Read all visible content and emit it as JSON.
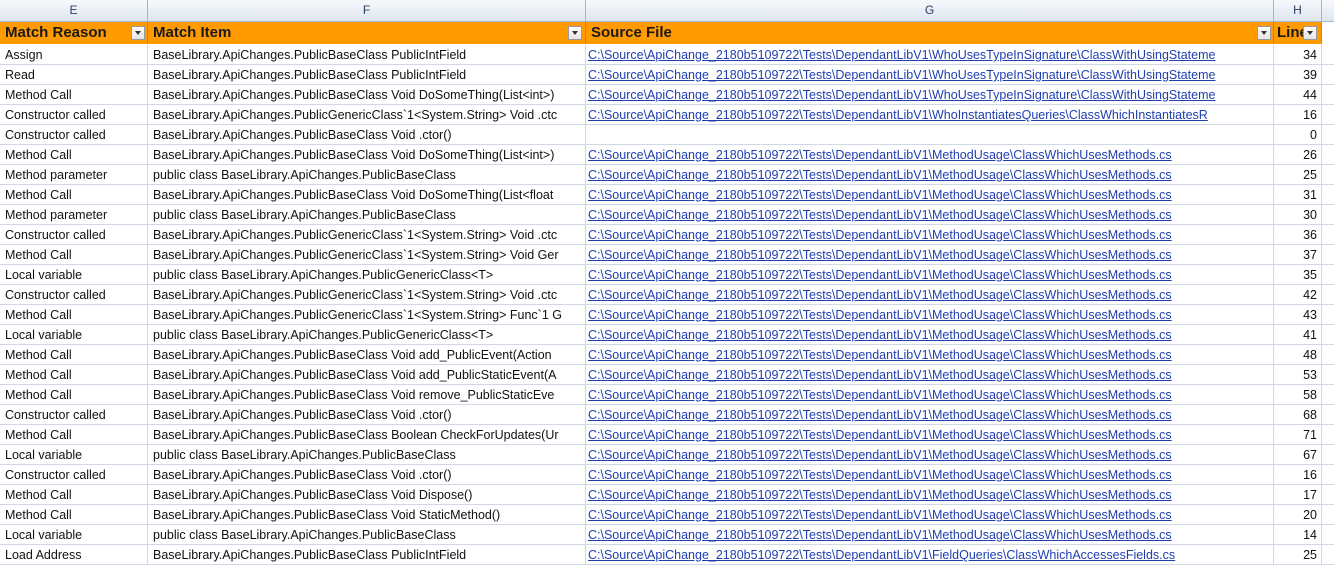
{
  "columns": [
    "E",
    "F",
    "G",
    "H"
  ],
  "header": {
    "match_reason": "Match Reason",
    "match_item": "Match Item",
    "source_file": "Source File",
    "line": "Line"
  },
  "rows": [
    {
      "reason": "Assign",
      "item": "BaseLibrary.ApiChanges.PublicBaseClass PublicIntField",
      "file": "C:\\Source\\ApiChange_2180b5109722\\Tests\\DependantLibV1\\WhoUsesTypeInSignature\\ClassWithUsingStateme",
      "line": "34"
    },
    {
      "reason": "Read",
      "item": "BaseLibrary.ApiChanges.PublicBaseClass PublicIntField",
      "file": "C:\\Source\\ApiChange_2180b5109722\\Tests\\DependantLibV1\\WhoUsesTypeInSignature\\ClassWithUsingStateme",
      "line": "39"
    },
    {
      "reason": "Method Call",
      "item": "BaseLibrary.ApiChanges.PublicBaseClass Void DoSomeThing(List<int>)",
      "file": "C:\\Source\\ApiChange_2180b5109722\\Tests\\DependantLibV1\\WhoUsesTypeInSignature\\ClassWithUsingStateme",
      "line": "44"
    },
    {
      "reason": "Constructor called",
      "item": "BaseLibrary.ApiChanges.PublicGenericClass`1<System.String> Void .ctc",
      "file": "C:\\Source\\ApiChange_2180b5109722\\Tests\\DependantLibV1\\WhoInstantiatesQueries\\ClassWhichInstantiatesR",
      "line": "16"
    },
    {
      "reason": "Constructor called",
      "item": "BaseLibrary.ApiChanges.PublicBaseClass Void .ctor()",
      "file": "",
      "line": "0"
    },
    {
      "reason": "Method Call",
      "item": "BaseLibrary.ApiChanges.PublicBaseClass Void DoSomeThing(List<int>)",
      "file": "C:\\Source\\ApiChange_2180b5109722\\Tests\\DependantLibV1\\MethodUsage\\ClassWhichUsesMethods.cs",
      "line": "26"
    },
    {
      "reason": "Method parameter",
      "item": "public class BaseLibrary.ApiChanges.PublicBaseClass",
      "file": "C:\\Source\\ApiChange_2180b5109722\\Tests\\DependantLibV1\\MethodUsage\\ClassWhichUsesMethods.cs",
      "line": "25"
    },
    {
      "reason": "Method Call",
      "item": "BaseLibrary.ApiChanges.PublicBaseClass Void DoSomeThing(List<float",
      "file": "C:\\Source\\ApiChange_2180b5109722\\Tests\\DependantLibV1\\MethodUsage\\ClassWhichUsesMethods.cs",
      "line": "31"
    },
    {
      "reason": "Method parameter",
      "item": "public class BaseLibrary.ApiChanges.PublicBaseClass",
      "file": "C:\\Source\\ApiChange_2180b5109722\\Tests\\DependantLibV1\\MethodUsage\\ClassWhichUsesMethods.cs",
      "line": "30"
    },
    {
      "reason": "Constructor called",
      "item": "BaseLibrary.ApiChanges.PublicGenericClass`1<System.String> Void .ctc",
      "file": "C:\\Source\\ApiChange_2180b5109722\\Tests\\DependantLibV1\\MethodUsage\\ClassWhichUsesMethods.cs",
      "line": "36"
    },
    {
      "reason": "Method Call",
      "item": "BaseLibrary.ApiChanges.PublicGenericClass`1<System.String> Void Ger",
      "file": "C:\\Source\\ApiChange_2180b5109722\\Tests\\DependantLibV1\\MethodUsage\\ClassWhichUsesMethods.cs",
      "line": "37"
    },
    {
      "reason": "Local variable",
      "item": "public class BaseLibrary.ApiChanges.PublicGenericClass<T>",
      "file": "C:\\Source\\ApiChange_2180b5109722\\Tests\\DependantLibV1\\MethodUsage\\ClassWhichUsesMethods.cs",
      "line": "35"
    },
    {
      "reason": "Constructor called",
      "item": "BaseLibrary.ApiChanges.PublicGenericClass`1<System.String> Void .ctc",
      "file": "C:\\Source\\ApiChange_2180b5109722\\Tests\\DependantLibV1\\MethodUsage\\ClassWhichUsesMethods.cs",
      "line": "42"
    },
    {
      "reason": "Method Call",
      "item": "BaseLibrary.ApiChanges.PublicGenericClass`1<System.String> Func`1 G",
      "file": "C:\\Source\\ApiChange_2180b5109722\\Tests\\DependantLibV1\\MethodUsage\\ClassWhichUsesMethods.cs",
      "line": "43"
    },
    {
      "reason": "Local variable",
      "item": "public class BaseLibrary.ApiChanges.PublicGenericClass<T>",
      "file": "C:\\Source\\ApiChange_2180b5109722\\Tests\\DependantLibV1\\MethodUsage\\ClassWhichUsesMethods.cs",
      "line": "41"
    },
    {
      "reason": "Method Call",
      "item": "BaseLibrary.ApiChanges.PublicBaseClass Void add_PublicEvent(Action",
      "file": "C:\\Source\\ApiChange_2180b5109722\\Tests\\DependantLibV1\\MethodUsage\\ClassWhichUsesMethods.cs",
      "line": "48"
    },
    {
      "reason": "Method Call",
      "item": "BaseLibrary.ApiChanges.PublicBaseClass Void add_PublicStaticEvent(A",
      "file": "C:\\Source\\ApiChange_2180b5109722\\Tests\\DependantLibV1\\MethodUsage\\ClassWhichUsesMethods.cs",
      "line": "53"
    },
    {
      "reason": "Method Call",
      "item": "BaseLibrary.ApiChanges.PublicBaseClass Void remove_PublicStaticEve",
      "file": "C:\\Source\\ApiChange_2180b5109722\\Tests\\DependantLibV1\\MethodUsage\\ClassWhichUsesMethods.cs",
      "line": "58"
    },
    {
      "reason": "Constructor called",
      "item": "BaseLibrary.ApiChanges.PublicBaseClass Void .ctor()",
      "file": "C:\\Source\\ApiChange_2180b5109722\\Tests\\DependantLibV1\\MethodUsage\\ClassWhichUsesMethods.cs",
      "line": "68"
    },
    {
      "reason": "Method Call",
      "item": "BaseLibrary.ApiChanges.PublicBaseClass Boolean CheckForUpdates(Ur",
      "file": "C:\\Source\\ApiChange_2180b5109722\\Tests\\DependantLibV1\\MethodUsage\\ClassWhichUsesMethods.cs",
      "line": "71"
    },
    {
      "reason": "Local variable",
      "item": "public class BaseLibrary.ApiChanges.PublicBaseClass",
      "file": "C:\\Source\\ApiChange_2180b5109722\\Tests\\DependantLibV1\\MethodUsage\\ClassWhichUsesMethods.cs",
      "line": "67"
    },
    {
      "reason": "Constructor called",
      "item": "BaseLibrary.ApiChanges.PublicBaseClass Void .ctor()",
      "file": "C:\\Source\\ApiChange_2180b5109722\\Tests\\DependantLibV1\\MethodUsage\\ClassWhichUsesMethods.cs",
      "line": "16"
    },
    {
      "reason": "Method Call",
      "item": "BaseLibrary.ApiChanges.PublicBaseClass Void Dispose()",
      "file": "C:\\Source\\ApiChange_2180b5109722\\Tests\\DependantLibV1\\MethodUsage\\ClassWhichUsesMethods.cs",
      "line": "17"
    },
    {
      "reason": "Method Call",
      "item": "BaseLibrary.ApiChanges.PublicBaseClass Void StaticMethod()",
      "file": "C:\\Source\\ApiChange_2180b5109722\\Tests\\DependantLibV1\\MethodUsage\\ClassWhichUsesMethods.cs",
      "line": "20"
    },
    {
      "reason": "Local variable",
      "item": "public class BaseLibrary.ApiChanges.PublicBaseClass",
      "file": "C:\\Source\\ApiChange_2180b5109722\\Tests\\DependantLibV1\\MethodUsage\\ClassWhichUsesMethods.cs",
      "line": "14"
    },
    {
      "reason": "Load Address",
      "item": "BaseLibrary.ApiChanges.PublicBaseClass PublicIntField",
      "file": "C:\\Source\\ApiChange_2180b5109722\\Tests\\DependantLibV1\\FieldQueries\\ClassWhichAccessesFields.cs",
      "line": "25"
    }
  ]
}
